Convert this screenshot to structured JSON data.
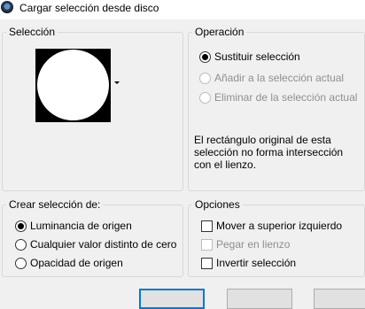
{
  "window": {
    "title": "Cargar selección desde disco"
  },
  "seleccion": {
    "legend": "Selección"
  },
  "operacion": {
    "legend": "Operación",
    "options": [
      "Sustituir selección",
      "Añadir a la selección actual",
      "Eliminar de la selección actual"
    ],
    "note": "El rectángulo original de esta selección no forma intersección con el lienzo."
  },
  "crear": {
    "legend": "Crear selección de:",
    "options": [
      "Luminancia de origen",
      "Cualquier valor distinto de cero",
      "Opacidad de origen"
    ]
  },
  "opciones": {
    "legend": "Opciones",
    "options": [
      "Mover a superior izquierdo",
      "Pegar en lienzo",
      "Invertir selección"
    ]
  },
  "icons": {
    "app": "app-icon",
    "dropdown": "dropdown-arrow-icon"
  },
  "colors": {
    "focus": "#0078d7",
    "disabled": "#8f8f8f"
  }
}
